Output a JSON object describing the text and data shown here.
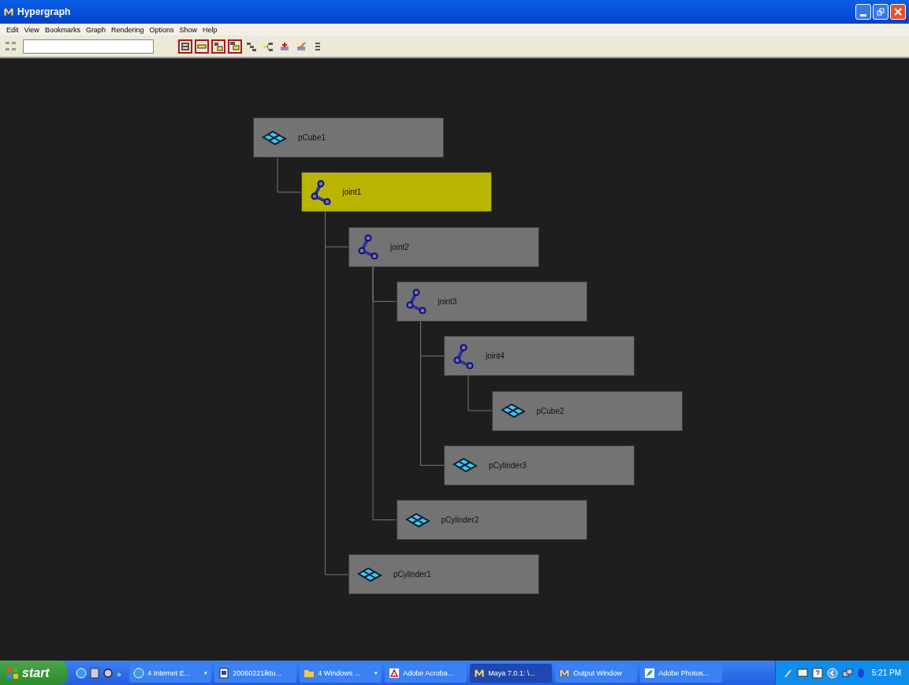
{
  "window": {
    "title": "Hypergraph"
  },
  "menu": [
    "Edit",
    "View",
    "Bookmarks",
    "Graph",
    "Rendering",
    "Options",
    "Show",
    "Help"
  ],
  "toolbar": {
    "buttons": [
      {
        "kind": "frame",
        "selected": true
      },
      {
        "kind": "collapse",
        "selected": true
      },
      {
        "kind": "stack",
        "selected": true
      },
      {
        "kind": "offset",
        "selected": true
      },
      {
        "kind": "tree",
        "selected": false
      },
      {
        "kind": "branch",
        "selected": false
      },
      {
        "kind": "add",
        "selected": false
      },
      {
        "kind": "edit",
        "selected": false
      },
      {
        "kind": "list",
        "selected": false
      }
    ]
  },
  "graph": {
    "nodes": [
      {
        "label": "pCube1",
        "kind": "mesh",
        "selected": false,
        "children": [
          {
            "label": "joint1",
            "kind": "joint",
            "selected": true,
            "children": [
              {
                "label": "joint2",
                "kind": "joint",
                "selected": false,
                "children": [
                  {
                    "label": "joint3",
                    "kind": "joint",
                    "selected": false,
                    "children": [
                      {
                        "label": "joint4",
                        "kind": "joint",
                        "selected": false,
                        "children": [
                          {
                            "label": "pCube2",
                            "kind": "mesh",
                            "selected": false
                          }
                        ]
                      },
                      {
                        "label": "pCylinder3",
                        "kind": "mesh",
                        "selected": false
                      }
                    ]
                  },
                  {
                    "label": "pCylinder2",
                    "kind": "mesh",
                    "selected": false
                  }
                ]
              },
              {
                "label": "pCylinder1",
                "kind": "mesh",
                "selected": false
              }
            ]
          }
        ]
      }
    ]
  },
  "taskbar": {
    "start": "start",
    "overflow": "»",
    "tasks": [
      {
        "label": "4 Internet E...",
        "kind": "ie",
        "caret": "▾",
        "selected": false
      },
      {
        "label": "20060221iktu...",
        "kind": "doc",
        "selected": false
      },
      {
        "label": "4 Windows ...",
        "kind": "folder",
        "caret": "▾",
        "selected": false
      },
      {
        "label": "Adobe Acroba...",
        "kind": "pdf",
        "selected": false
      },
      {
        "label": "Maya 7.0.1: \\...",
        "kind": "maya",
        "selected": true
      },
      {
        "label": "Output Window",
        "kind": "maya",
        "selected": false
      },
      {
        "label": "Adobe Photos...",
        "kind": "ps",
        "selected": false
      }
    ],
    "clock": "5:21 PM"
  }
}
